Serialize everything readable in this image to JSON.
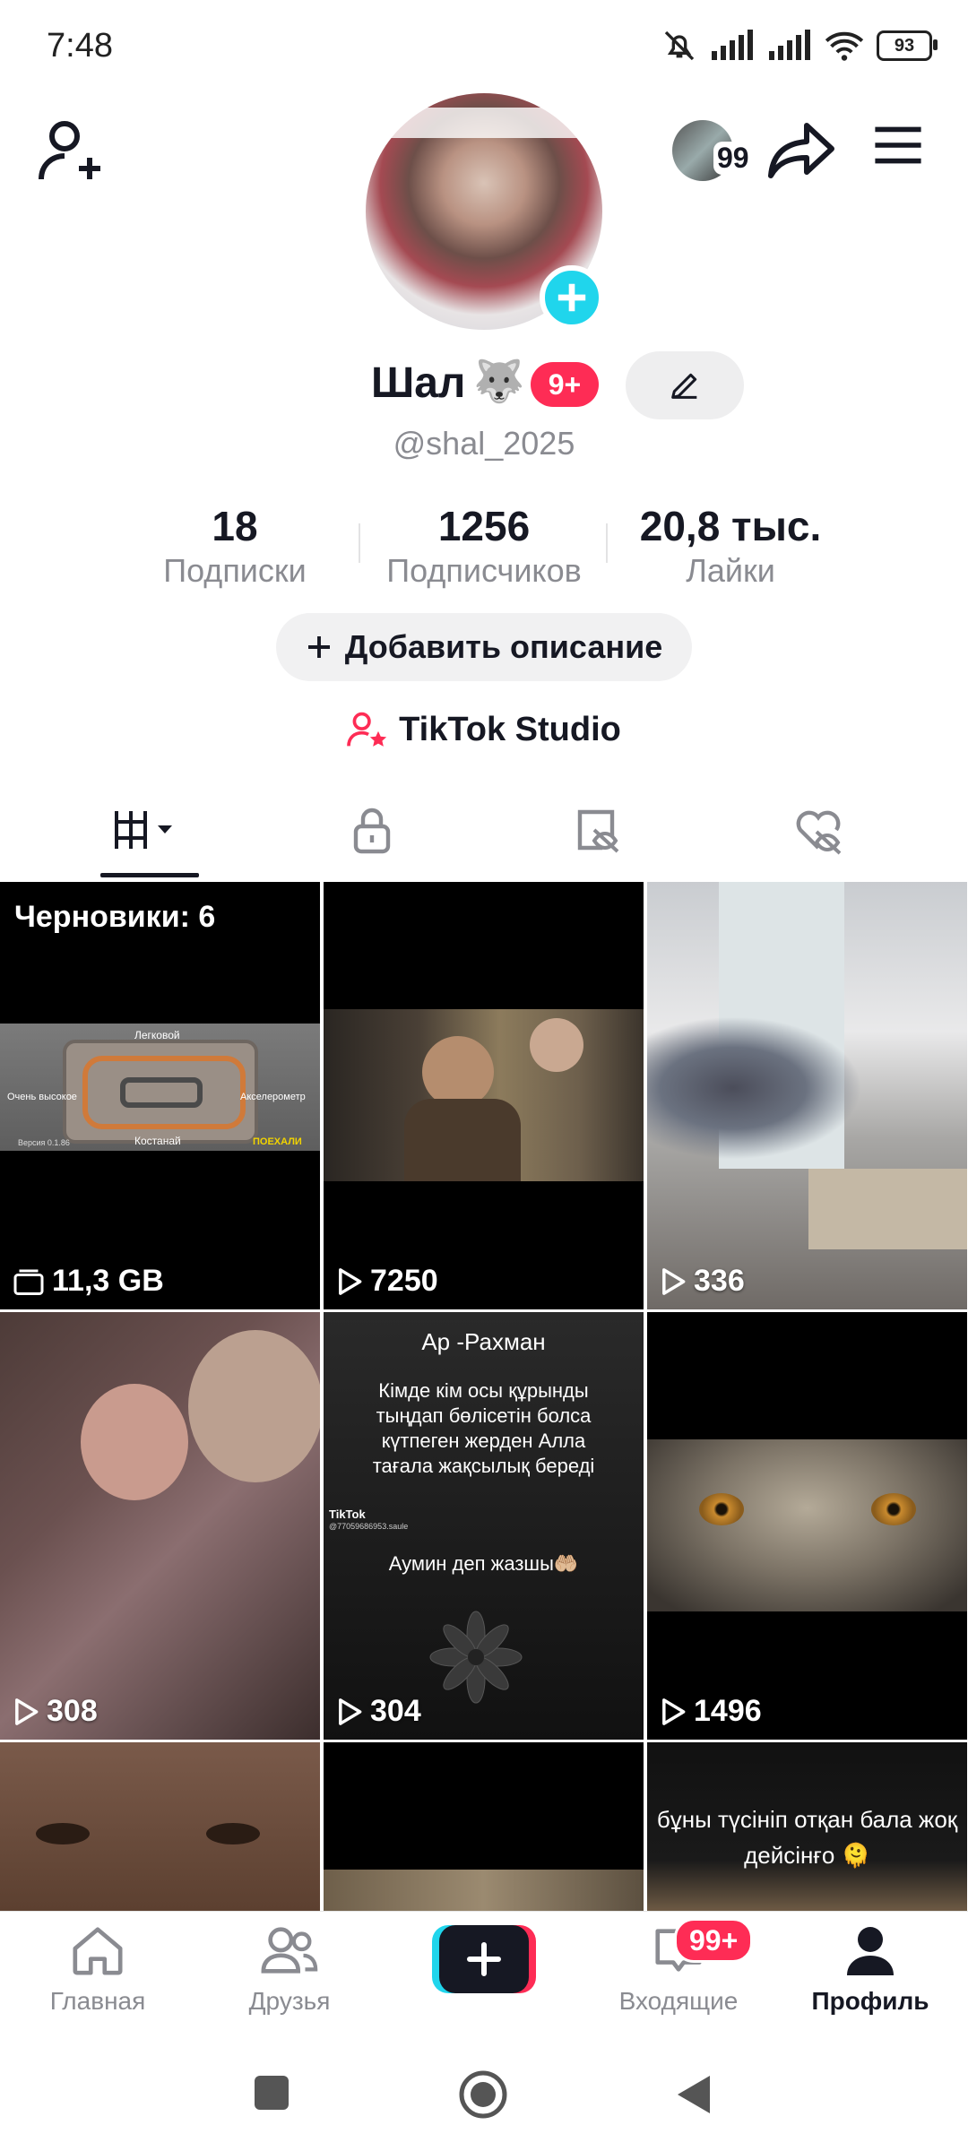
{
  "status": {
    "time": "7:48",
    "battery": "93"
  },
  "header": {
    "notifications_count": "99"
  },
  "profile": {
    "display_name": "Шал",
    "name_emoji": "🐺",
    "badge": "9+",
    "username": "@shal_2025"
  },
  "stats": [
    {
      "value": "18",
      "label": "Подписки"
    },
    {
      "value": "1256",
      "label": "Подписчиков"
    },
    {
      "value": "20,8 тыс.",
      "label": "Лайки"
    }
  ],
  "add_bio_label": "Добавить описание",
  "studio_label": "TikTok Studio",
  "tabs": [
    "videos-grid-icon",
    "lock-icon",
    "tag-hidden-icon",
    "heart-hidden-icon"
  ],
  "grid": {
    "drafts_label": "Черновики: 6",
    "drafts_size": "11,3 GB",
    "draft_thumb": {
      "top": "Легковой",
      "left": "Очень высокое",
      "right": "Акселерометр",
      "bottom": "Костанай",
      "version": "Версия 0.1.86",
      "go": "ПОЕХАЛИ"
    },
    "views": [
      "7250",
      "336",
      "308",
      "304",
      "1496"
    ],
    "text_post": {
      "title": "Ар -Рахман",
      "body": "Кімде кім осы құрынды тыңдап бөлісетін болса күтпеген жерден Алла тағала жақсылық береді",
      "footer": "Аумин деп жазшы🤲🏼",
      "tiktok": "TikTok",
      "handle": "@77059686953.saule"
    },
    "caption_post": "бұны түсініп отқан бала жоқ дейсінғо 🫠"
  },
  "bottom_nav": {
    "home": "Главная",
    "friends": "Друзья",
    "inbox": "Входящие",
    "inbox_badge": "99+",
    "profile": "Профиль"
  },
  "colors": {
    "accent": "#fe2c55",
    "cyan": "#20d5ec",
    "text": "#161823",
    "muted": "#8a8b91"
  }
}
